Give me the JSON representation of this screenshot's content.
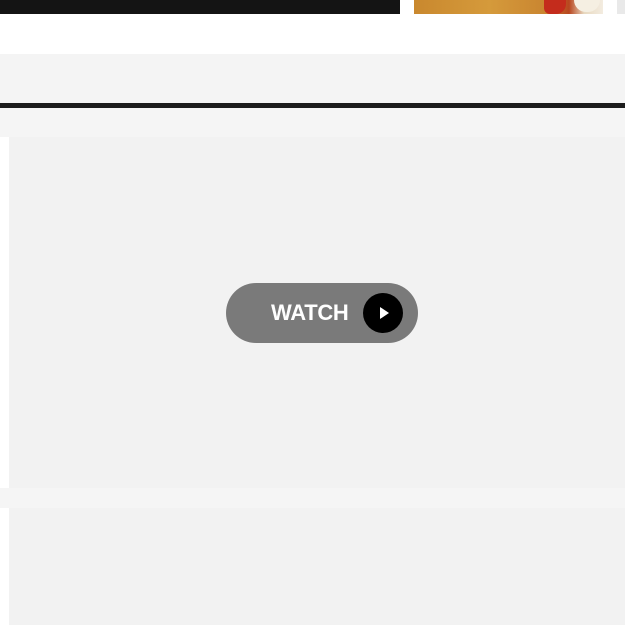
{
  "video": {
    "watch_label": "WATCH",
    "play_icon": "play-icon"
  },
  "colors": {
    "button_bg": "#7a7a7a",
    "play_circle_bg": "#000000",
    "placeholder_bg": "#f2f2f2",
    "divider": "#1c1c1c"
  }
}
